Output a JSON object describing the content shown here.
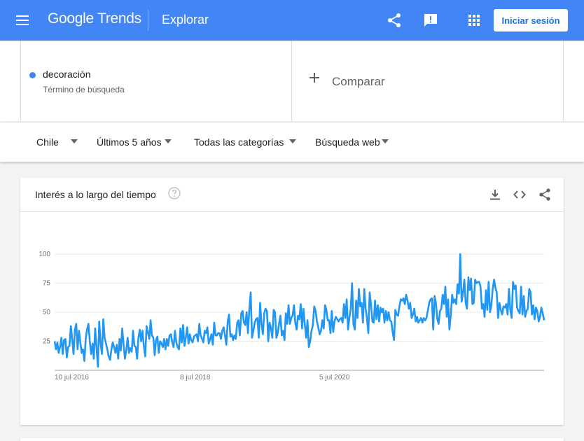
{
  "topbar": {
    "logo_google": "Google",
    "logo_trends": "Trends",
    "section": "Explorar",
    "login_label": "Iniciar sesión",
    "bg_color": "#4285f4",
    "icons": [
      "menu-icon",
      "share-icon",
      "feedback-icon",
      "apps-icon"
    ]
  },
  "terms": {
    "term": "decoración",
    "term_type": "Término de búsqueda",
    "term_color": "#4285f4",
    "compare_label": "Comparar"
  },
  "filters": {
    "region": "Chile",
    "period": "Últimos 5 años",
    "category": "Todas las categorías",
    "search_type": "Búsqueda web"
  },
  "interest_card": {
    "title": "Interés a lo largo del tiempo",
    "icons": [
      "help-icon",
      "download-icon",
      "embed-icon",
      "share-icon"
    ]
  },
  "chart_data": {
    "type": "line",
    "series_color": "#2196f3",
    "ylim": [
      0,
      100
    ],
    "yticks": [
      "100",
      "75",
      "50",
      "25"
    ],
    "xticks": [
      "10 jul 2016",
      "8 jul 2018",
      "5 jul 2020"
    ],
    "grid": true,
    "values": [
      25,
      18,
      24,
      15,
      20,
      28,
      14,
      26,
      27,
      11,
      20,
      21,
      38,
      27,
      14,
      35,
      40,
      18,
      34,
      24,
      15,
      18,
      8,
      27,
      35,
      40,
      25,
      14,
      23,
      10,
      36,
      19,
      3,
      42,
      23,
      14,
      44,
      28,
      23,
      18,
      12,
      9,
      18,
      24,
      20,
      15,
      22,
      10,
      27,
      17,
      36,
      22,
      10,
      17,
      28,
      15,
      19,
      16,
      34,
      21,
      20,
      10,
      28,
      35,
      25,
      34,
      21,
      12,
      38,
      33,
      27,
      43,
      30,
      28,
      13,
      26,
      29,
      15,
      25,
      23,
      20,
      27,
      18,
      27,
      21,
      30,
      31,
      24,
      20,
      34,
      24,
      20,
      18,
      36,
      24,
      39,
      21,
      28,
      37,
      23,
      31,
      26,
      24,
      29,
      30,
      31,
      25,
      40,
      30,
      27,
      24,
      34,
      32,
      37,
      23,
      27,
      31,
      22,
      41,
      30,
      30,
      32,
      32,
      27,
      34,
      37,
      30,
      22,
      42,
      48,
      29,
      31,
      26,
      30,
      27,
      41,
      43,
      30,
      49,
      51,
      41,
      39,
      50,
      32,
      53,
      67,
      28,
      34,
      41,
      44,
      45,
      28,
      58,
      40,
      31,
      49,
      53,
      51,
      25,
      41,
      36,
      28,
      52,
      50,
      28,
      32,
      40,
      47,
      30,
      34,
      26,
      49,
      40,
      56,
      40,
      45,
      47,
      56,
      41,
      35,
      47,
      44,
      57,
      36,
      53,
      40,
      28,
      43,
      20,
      25,
      34,
      39,
      55,
      51,
      42,
      37,
      31,
      34,
      43,
      36,
      56,
      52,
      43,
      43,
      32,
      51,
      33,
      42,
      46,
      44,
      42,
      44,
      45,
      41,
      57,
      45,
      61,
      35,
      45,
      53,
      75,
      40,
      35,
      60,
      45,
      70,
      55,
      58,
      41,
      70,
      53,
      45,
      32,
      67,
      57,
      42,
      41,
      60,
      44,
      56,
      42,
      54,
      50,
      53,
      41,
      51,
      43,
      50,
      43,
      42,
      33,
      26,
      52,
      48,
      47,
      55,
      61,
      60,
      62,
      57,
      65,
      60,
      53,
      58,
      45,
      48,
      53,
      42,
      46,
      41,
      43,
      45,
      41,
      45,
      43,
      45,
      51,
      58,
      61,
      62,
      35,
      64,
      58,
      44,
      40,
      51,
      53,
      65,
      57,
      72,
      46,
      61,
      35,
      48,
      65,
      58,
      61,
      57,
      74,
      66,
      100,
      59,
      66,
      78,
      58,
      53,
      80,
      69,
      79,
      57,
      58,
      78,
      75,
      76,
      76,
      72,
      53,
      57,
      46,
      69,
      52,
      76,
      50,
      56,
      70,
      78,
      71,
      67,
      45,
      58,
      52,
      48,
      55,
      54,
      57,
      48,
      70,
      52,
      45,
      76,
      70,
      73,
      54,
      51,
      49,
      72,
      48,
      64,
      46,
      51,
      53,
      70,
      67,
      48,
      56,
      44,
      54,
      51,
      42,
      46,
      54,
      49,
      43
    ]
  }
}
